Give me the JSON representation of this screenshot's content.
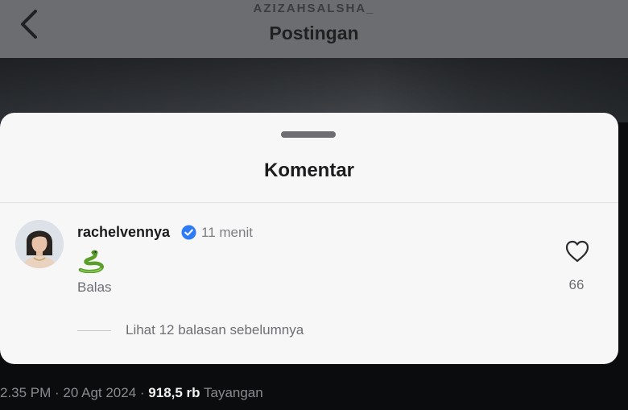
{
  "header": {
    "username": "AZIZAHSALSHA_",
    "title": "Postingan"
  },
  "sheet": {
    "title": "Komentar"
  },
  "comment": {
    "username": "rachelvennya",
    "time": "11 menit",
    "emoji": "snake",
    "reply_label": "Balas",
    "like_count": "66",
    "view_replies": "Lihat 12 balasan sebelumnya"
  },
  "footer": {
    "timestamp": "2.35 PM · 20 Agt 2024 ·",
    "views": "918,5 rb",
    "views_label": "Tayangan"
  },
  "colors": {
    "verified": "#2f7bf5",
    "sheet_bg": "#f7f7f8"
  }
}
